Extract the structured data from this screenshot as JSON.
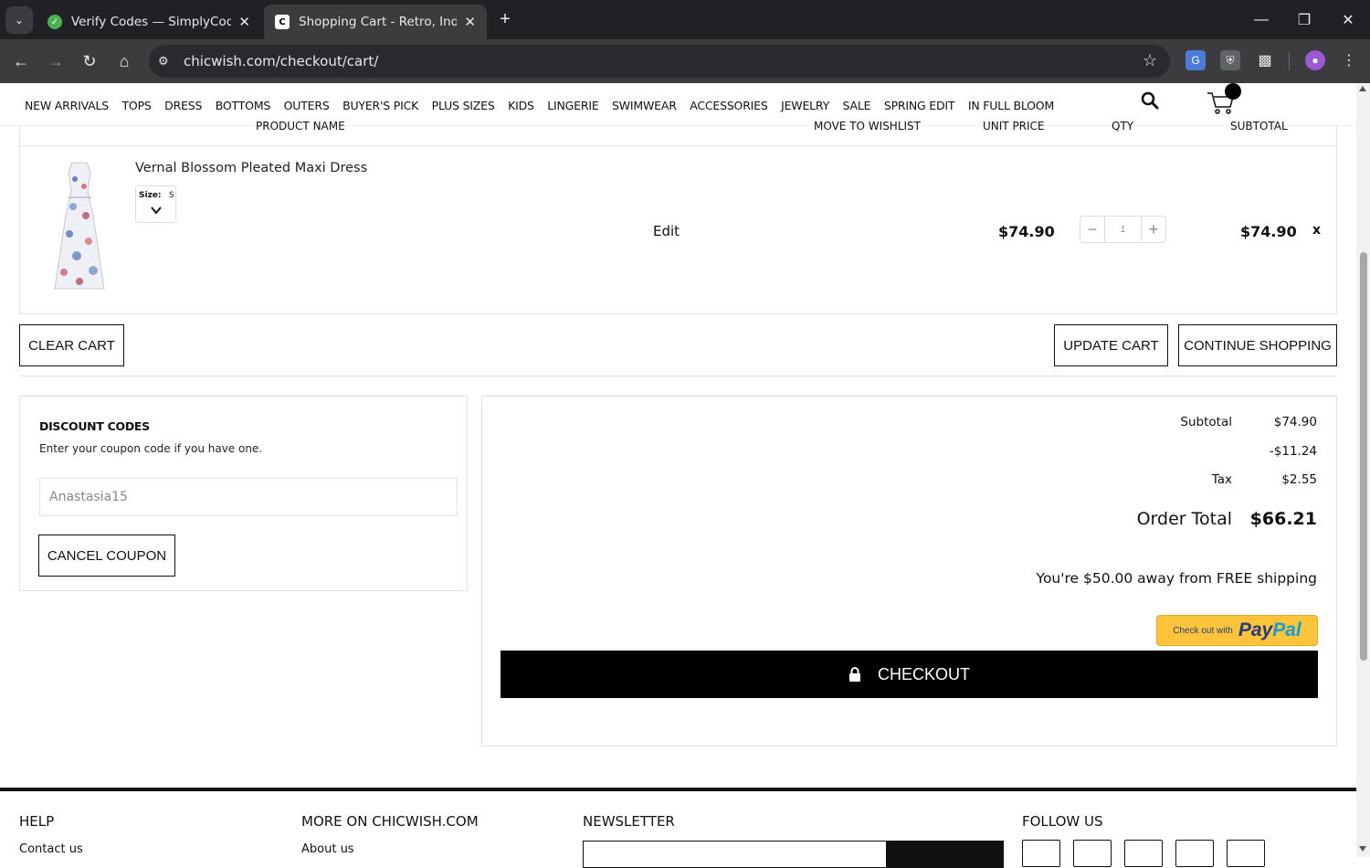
{
  "browser": {
    "tabs": [
      {
        "title": "Verify Codes — SimplyCodes",
        "favicon": "check-icon",
        "active": false
      },
      {
        "title": "Shopping Cart - Retro, Indie and Unique Fashion",
        "favicon": "C",
        "active": true
      }
    ],
    "url": "chicwish.com/checkout/cart/"
  },
  "nav": {
    "items": [
      "NEW ARRIVALS",
      "TOPS",
      "DRESS",
      "BOTTOMS",
      "OUTERS",
      "BUYER'S PICK",
      "PLUS SIZES",
      "KIDS",
      "LINGERIE",
      "SWIMWEAR",
      "ACCESSORIES",
      "JEWELRY",
      "SALE",
      "SPRING EDIT",
      "IN FULL BLOOM"
    ]
  },
  "cart": {
    "columns": {
      "product": "PRODUCT NAME",
      "wishlist": "MOVE TO WISHLIST",
      "unit_price": "UNIT PRICE",
      "qty": "QTY",
      "subtotal": "SUBTOTAL"
    },
    "item": {
      "name": "Vernal Blossom Pleated Maxi Dress",
      "size_label": "Size:",
      "size_value": "S",
      "edit": "Edit",
      "unit_price": "$74.90",
      "qty": "1",
      "subtotal": "$74.90",
      "remove": "x"
    },
    "buttons": {
      "clear": "CLEAR CART",
      "update": "UPDATE CART",
      "continue": "CONTINUE SHOPPING"
    }
  },
  "discount": {
    "title": "DISCOUNT CODES",
    "hint": "Enter your coupon code if you have one.",
    "code": "Anastasia15",
    "cancel": "CANCEL COUPON"
  },
  "summary": {
    "subtotal_label": "Subtotal",
    "subtotal_value": "$74.90",
    "discount_value": "-$11.24",
    "tax_label": "Tax",
    "tax_value": "$2.55",
    "total_label": "Order Total",
    "total_value": "$66.21",
    "free_shipping": "You're $50.00 away from FREE shipping",
    "paypal_small": "Check out with",
    "paypal_pay": "Pay",
    "paypal_pal": "Pal",
    "checkout": "CHECKOUT"
  },
  "footer": {
    "help": "HELP",
    "contact": "Contact us",
    "more": "MORE ON CHICWISH.COM",
    "about": "About us",
    "newsletter": "NEWSLETTER",
    "follow": "FOLLOW US"
  },
  "colors": {
    "chrome_dark": "#202124",
    "chrome_toolbar": "#3c3c3f",
    "paypal_yellow": "#ffc439",
    "paypal_blue": "#253b80",
    "paypal_light_blue": "#179bd7",
    "checkout_black": "#000000"
  }
}
